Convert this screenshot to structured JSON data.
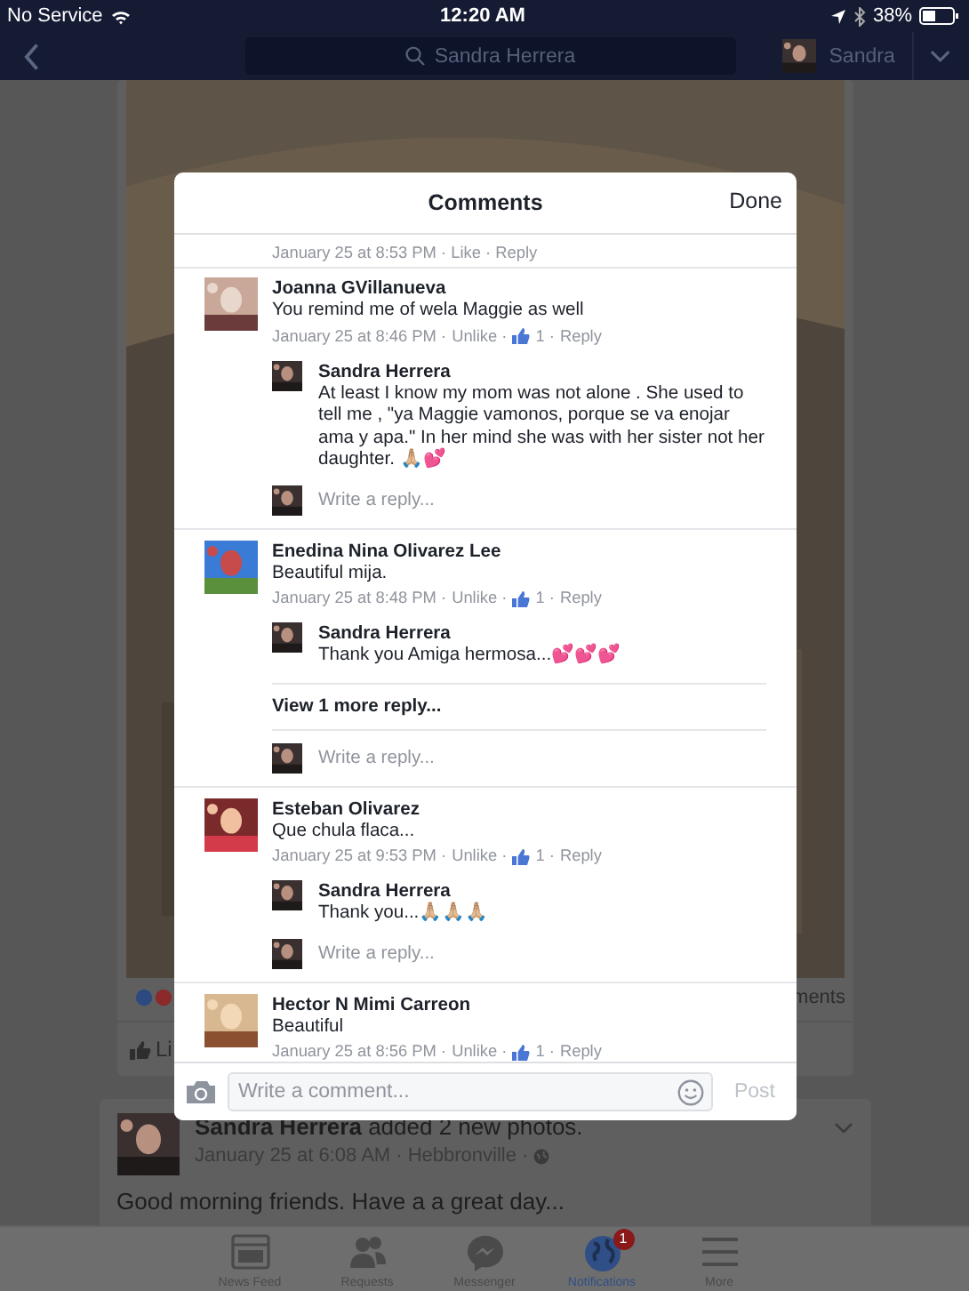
{
  "status_bar": {
    "carrier": "No Service",
    "time": "12:20 AM",
    "battery": "38%"
  },
  "nav": {
    "search": "Sandra Herrera",
    "profile_name": "Sandra"
  },
  "background_post": {
    "like_label": "Li",
    "comments_label": "ments"
  },
  "next_post": {
    "author": "Sandra Herrera",
    "action": "added 2 new photos.",
    "meta": "January 25 at 6:08 AM · Hebbronville ·",
    "text": "Good morning friends.  Have a a great day..."
  },
  "modal": {
    "title": "Comments",
    "done": "Done",
    "cut_meta": "January 25 at 8:53 PM · Like · Reply",
    "comments": [
      {
        "author": "Joanna GVillanueva",
        "text": "You remind me of wela Maggie as well",
        "time": "January 25 at 8:46 PM ·",
        "like_action": "Unlike ·",
        "liked": true,
        "likes": "1 ·",
        "reply": "Reply",
        "replies": [
          {
            "author": "Sandra Herrera",
            "text": "At least I know my mom was not alone . She used to tell me , \"ya Maggie vamonos, porque se va enojar ama y apa.\" In her mind she was with her sister not her daughter. 🙏🏼💕"
          }
        ],
        "reply_placeholder": "Write a reply..."
      },
      {
        "author": "Enedina Nina Olivarez Lee",
        "text": "Beautiful mija.",
        "time": "January 25 at 8:48 PM ·",
        "like_action": "Unlike ·",
        "liked": true,
        "likes": "1 ·",
        "reply": "Reply",
        "replies": [
          {
            "author": "Sandra Herrera",
            "text": "Thank you Amiga hermosa...💕💕💕"
          }
        ],
        "more_replies": "View 1 more reply...",
        "reply_placeholder": "Write a reply..."
      },
      {
        "author": "Esteban Olivarez",
        "text": "Que chula flaca...",
        "time": "January 25 at 9:53 PM ·",
        "like_action": "Unlike ·",
        "liked": true,
        "likes": "1 ·",
        "reply": "Reply",
        "replies": [
          {
            "author": "Sandra Herrera",
            "text": "Thank you...🙏🏼🙏🏼🙏🏼"
          }
        ],
        "reply_placeholder": "Write a reply..."
      },
      {
        "author": "Hector N Mimi Carreon",
        "text": "Beautiful",
        "time": "January 25 at 8:56 PM ·",
        "like_action": "Unlike ·",
        "liked": true,
        "likes": "1 ·",
        "reply": "Reply"
      }
    ],
    "composer": {
      "placeholder": "Write a comment...",
      "post": "Post"
    }
  },
  "tabs": [
    {
      "label": "News Feed",
      "selected": false
    },
    {
      "label": "Requests",
      "selected": false
    },
    {
      "label": "Messenger",
      "selected": false
    },
    {
      "label": "Notifications",
      "selected": true,
      "badge": "1"
    },
    {
      "label": "More",
      "selected": false
    }
  ]
}
